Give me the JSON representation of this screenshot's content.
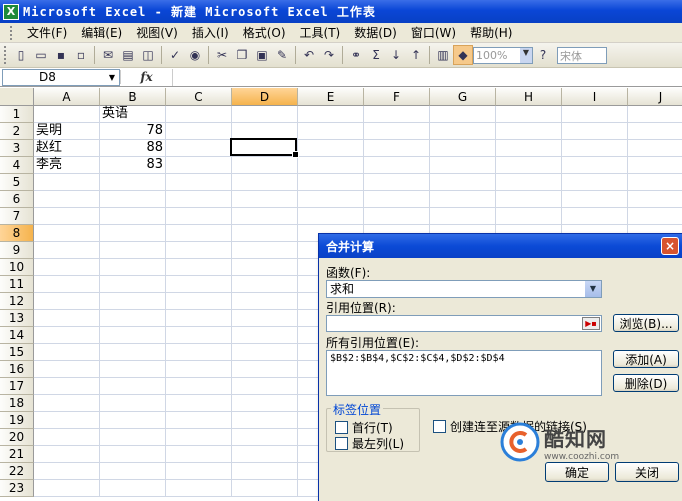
{
  "window": {
    "title": "Microsoft Excel - 新建 Microsoft Excel 工作表",
    "icon": "excel-icon"
  },
  "menu": [
    {
      "label": "文件(F)"
    },
    {
      "label": "编辑(E)"
    },
    {
      "label": "视图(V)"
    },
    {
      "label": "插入(I)"
    },
    {
      "label": "格式(O)"
    },
    {
      "label": "工具(T)"
    },
    {
      "label": "数据(D)"
    },
    {
      "label": "窗口(W)"
    },
    {
      "label": "帮助(H)"
    }
  ],
  "toolbar": {
    "zoom": "100%",
    "font": "宋体",
    "sum_symbol": "Σ"
  },
  "formula_bar": {
    "name_box": "D8",
    "fx_label": "fx",
    "formula": ""
  },
  "sheet": {
    "columns": [
      "A",
      "B",
      "C",
      "D",
      "E",
      "F",
      "G",
      "H",
      "I",
      "J"
    ],
    "selected_column": "D",
    "selected_row": "8",
    "rows": [
      {
        "n": "1",
        "cells": [
          "",
          "英语"
        ]
      },
      {
        "n": "2",
        "cells": [
          "吴明",
          "78"
        ]
      },
      {
        "n": "3",
        "cells": [
          "赵红",
          "88"
        ]
      },
      {
        "n": "4",
        "cells": [
          "李亮",
          "83"
        ]
      },
      {
        "n": "5",
        "cells": []
      },
      {
        "n": "6",
        "cells": []
      },
      {
        "n": "7",
        "cells": []
      },
      {
        "n": "8",
        "cells": []
      },
      {
        "n": "9",
        "cells": []
      },
      {
        "n": "10",
        "cells": []
      },
      {
        "n": "11",
        "cells": []
      },
      {
        "n": "12",
        "cells": []
      },
      {
        "n": "13",
        "cells": []
      },
      {
        "n": "14",
        "cells": []
      },
      {
        "n": "15",
        "cells": []
      },
      {
        "n": "16",
        "cells": []
      },
      {
        "n": "17",
        "cells": []
      },
      {
        "n": "18",
        "cells": []
      },
      {
        "n": "19",
        "cells": []
      },
      {
        "n": "20",
        "cells": []
      },
      {
        "n": "21",
        "cells": []
      },
      {
        "n": "22",
        "cells": []
      },
      {
        "n": "23",
        "cells": []
      }
    ]
  },
  "dialog": {
    "title": "合并计算",
    "function_label": "函数(F):",
    "function_value": "求和",
    "reference_label": "引用位置(R):",
    "reference_value": "",
    "browse_button": "浏览(B)...",
    "all_refs_label": "所有引用位置(E):",
    "all_refs_value": "$B$2:$B$4,$C$2:$C$4,$D$2:$D$4",
    "add_button": "添加(A)",
    "delete_button": "删除(D)",
    "labels_group": "标签位置",
    "top_row_label": "首行(T)",
    "left_col_label": "最左列(L)",
    "link_label": "创建连至源数据的链接(S)",
    "ok_button": "确定",
    "close_button": "关闭",
    "close_icon": "×"
  },
  "watermark": {
    "title": "酷知网",
    "url": "www.coozhi.com"
  }
}
